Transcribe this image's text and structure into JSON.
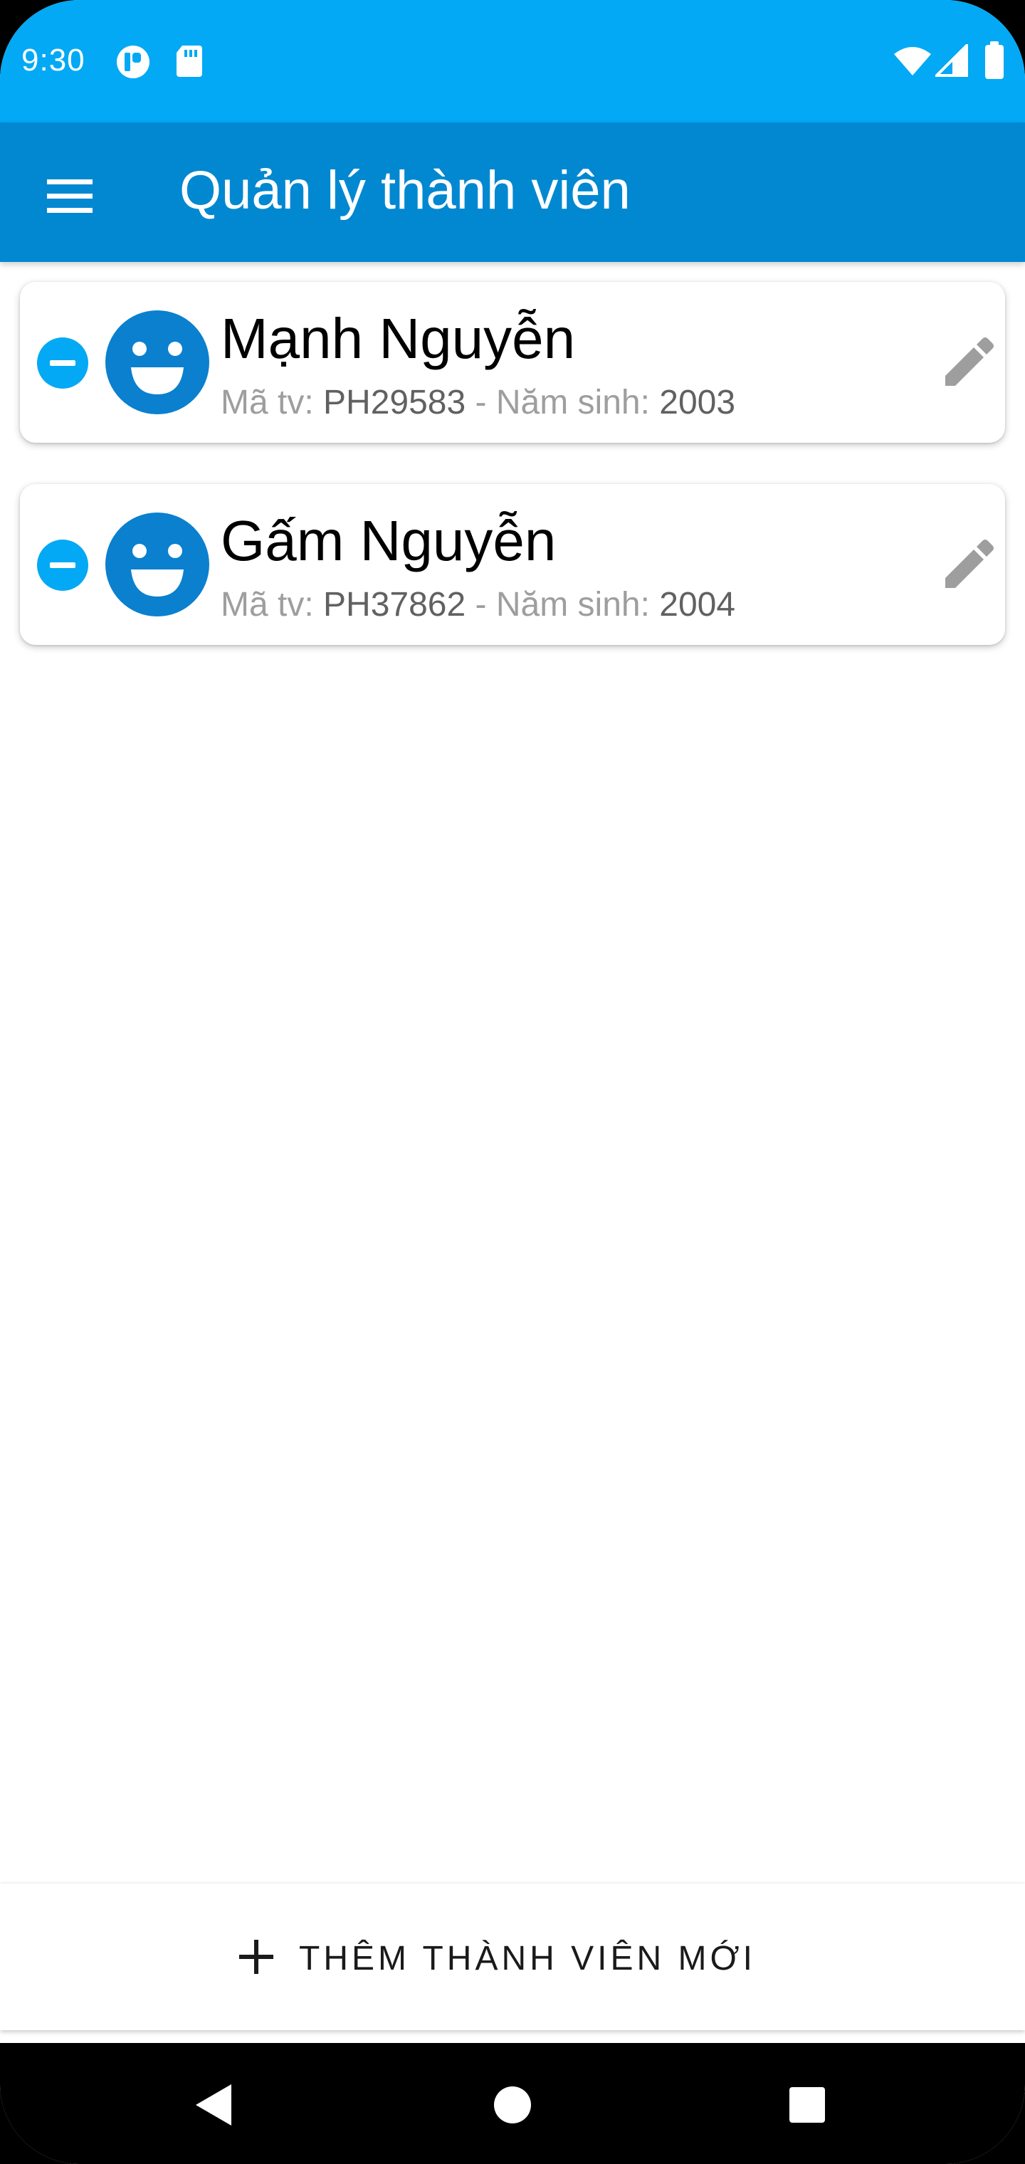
{
  "status_bar": {
    "time": "9:30",
    "left_icons": [
      "app-notification-icon",
      "sd-card-icon"
    ],
    "right_icons": [
      "wifi-icon",
      "signal-icon",
      "battery-icon"
    ],
    "color": "#03a9f4"
  },
  "app_bar": {
    "title": "Quản lý thành viên",
    "menu_icon": "menu-icon",
    "color": "#0288d1"
  },
  "members": [
    {
      "name": "Mạnh Nguyễn",
      "id_label": "Mã tv: ",
      "id": "PH29583",
      "separator": " - ",
      "year_label": "Năm sinh: ",
      "year": "2003"
    },
    {
      "name": "Gấm Nguyễn",
      "id_label": "Mã tv: ",
      "id": "PH37862",
      "separator": " - ",
      "year_label": "Năm sinh: ",
      "year": "2004"
    }
  ],
  "add_button": {
    "label": "THÊM THÀNH VIÊN MỚI",
    "icon": "plus-icon"
  },
  "nav_bar": {
    "icons": [
      "back-icon",
      "home-icon",
      "recents-icon"
    ]
  },
  "colors": {
    "accent": "#03a9f4",
    "primary": "#0288d1",
    "avatar": "#0a80cf"
  }
}
